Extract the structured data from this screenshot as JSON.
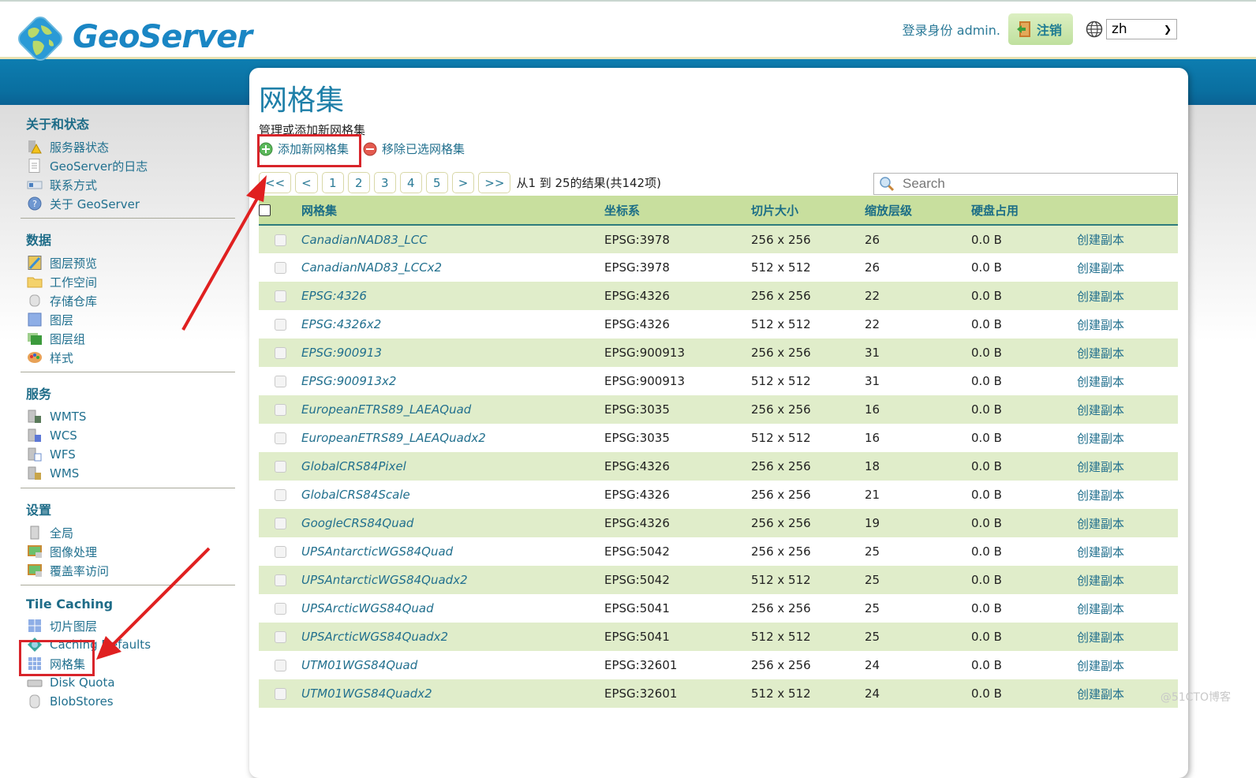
{
  "header": {
    "logo_text": "GeoServer",
    "login_text": "登录身份 admin.",
    "logout_label": "注销",
    "language": "zh"
  },
  "sidebar": {
    "sections": [
      {
        "title": "关于和状态",
        "items": [
          {
            "label": "服务器状态",
            "icon": "server-status-icon"
          },
          {
            "label": "GeoServer的日志",
            "icon": "log-document-icon"
          },
          {
            "label": "联系方式",
            "icon": "contact-card-icon"
          },
          {
            "label": "关于 GeoServer",
            "icon": "about-info-icon"
          }
        ]
      },
      {
        "title": "数据",
        "items": [
          {
            "label": "图层预览",
            "icon": "layer-preview-icon"
          },
          {
            "label": "工作空间",
            "icon": "folder-icon"
          },
          {
            "label": "存储仓库",
            "icon": "database-icon"
          },
          {
            "label": "图层",
            "icon": "layer-icon"
          },
          {
            "label": "图层组",
            "icon": "layer-group-icon"
          },
          {
            "label": "样式",
            "icon": "palette-icon"
          }
        ]
      },
      {
        "title": "服务",
        "items": [
          {
            "label": "WMTS",
            "icon": "wmts-service-icon"
          },
          {
            "label": "WCS",
            "icon": "wcs-service-icon"
          },
          {
            "label": "WFS",
            "icon": "wfs-service-icon"
          },
          {
            "label": "WMS",
            "icon": "wms-service-icon"
          }
        ]
      },
      {
        "title": "设置",
        "items": [
          {
            "label": "全局",
            "icon": "global-server-icon"
          },
          {
            "label": "图像处理",
            "icon": "image-processing-icon"
          },
          {
            "label": "覆盖率访问",
            "icon": "coverage-access-icon"
          }
        ]
      },
      {
        "title": "Tile Caching",
        "items": [
          {
            "label": "切片图层",
            "icon": "tile-layers-icon"
          },
          {
            "label": "Caching Defaults",
            "icon": "caching-defaults-icon"
          },
          {
            "label": "网格集",
            "icon": "gridset-icon"
          },
          {
            "label": "Disk Quota",
            "icon": "disk-quota-icon"
          },
          {
            "label": "BlobStores",
            "icon": "blobstore-icon"
          }
        ]
      }
    ]
  },
  "main": {
    "title": "网格集",
    "description": "管理或添加新网格集",
    "add_label": "添加新网格集",
    "remove_label": "移除已选网格集",
    "pager": {
      "first": "<<",
      "prev": "<",
      "pages": [
        "1",
        "2",
        "3",
        "4",
        "5"
      ],
      "next": ">",
      "last": ">>",
      "info": "从1 到 25的结果(共142项)"
    },
    "search_placeholder": "Search",
    "columns": [
      "网格集",
      "坐标系",
      "切片大小",
      "缩放层级",
      "硬盘占用",
      ""
    ],
    "rows": [
      {
        "name": "CanadianNAD83_LCC",
        "crs": "EPSG:3978",
        "tile_size": "256 x 256",
        "zoom_levels": "26",
        "disk": "0.0 B",
        "action": "创建副本"
      },
      {
        "name": "CanadianNAD83_LCCx2",
        "crs": "EPSG:3978",
        "tile_size": "512 x 512",
        "zoom_levels": "26",
        "disk": "0.0 B",
        "action": "创建副本"
      },
      {
        "name": "EPSG:4326",
        "crs": "EPSG:4326",
        "tile_size": "256 x 256",
        "zoom_levels": "22",
        "disk": "0.0 B",
        "action": "创建副本"
      },
      {
        "name": "EPSG:4326x2",
        "crs": "EPSG:4326",
        "tile_size": "512 x 512",
        "zoom_levels": "22",
        "disk": "0.0 B",
        "action": "创建副本"
      },
      {
        "name": "EPSG:900913",
        "crs": "EPSG:900913",
        "tile_size": "256 x 256",
        "zoom_levels": "31",
        "disk": "0.0 B",
        "action": "创建副本"
      },
      {
        "name": "EPSG:900913x2",
        "crs": "EPSG:900913",
        "tile_size": "512 x 512",
        "zoom_levels": "31",
        "disk": "0.0 B",
        "action": "创建副本"
      },
      {
        "name": "EuropeanETRS89_LAEAQuad",
        "crs": "EPSG:3035",
        "tile_size": "256 x 256",
        "zoom_levels": "16",
        "disk": "0.0 B",
        "action": "创建副本"
      },
      {
        "name": "EuropeanETRS89_LAEAQuadx2",
        "crs": "EPSG:3035",
        "tile_size": "512 x 512",
        "zoom_levels": "16",
        "disk": "0.0 B",
        "action": "创建副本"
      },
      {
        "name": "GlobalCRS84Pixel",
        "crs": "EPSG:4326",
        "tile_size": "256 x 256",
        "zoom_levels": "18",
        "disk": "0.0 B",
        "action": "创建副本"
      },
      {
        "name": "GlobalCRS84Scale",
        "crs": "EPSG:4326",
        "tile_size": "256 x 256",
        "zoom_levels": "21",
        "disk": "0.0 B",
        "action": "创建副本"
      },
      {
        "name": "GoogleCRS84Quad",
        "crs": "EPSG:4326",
        "tile_size": "256 x 256",
        "zoom_levels": "19",
        "disk": "0.0 B",
        "action": "创建副本"
      },
      {
        "name": "UPSAntarcticWGS84Quad",
        "crs": "EPSG:5042",
        "tile_size": "256 x 256",
        "zoom_levels": "25",
        "disk": "0.0 B",
        "action": "创建副本"
      },
      {
        "name": "UPSAntarcticWGS84Quadx2",
        "crs": "EPSG:5042",
        "tile_size": "512 x 512",
        "zoom_levels": "25",
        "disk": "0.0 B",
        "action": "创建副本"
      },
      {
        "name": "UPSArcticWGS84Quad",
        "crs": "EPSG:5041",
        "tile_size": "256 x 256",
        "zoom_levels": "25",
        "disk": "0.0 B",
        "action": "创建副本"
      },
      {
        "name": "UPSArcticWGS84Quadx2",
        "crs": "EPSG:5041",
        "tile_size": "512 x 512",
        "zoom_levels": "25",
        "disk": "0.0 B",
        "action": "创建副本"
      },
      {
        "name": "UTM01WGS84Quad",
        "crs": "EPSG:32601",
        "tile_size": "256 x 256",
        "zoom_levels": "24",
        "disk": "0.0 B",
        "action": "创建副本"
      },
      {
        "name": "UTM01WGS84Quadx2",
        "crs": "EPSG:32601",
        "tile_size": "512 x 512",
        "zoom_levels": "24",
        "disk": "0.0 B",
        "action": "创建副本"
      }
    ]
  },
  "watermark": "@51CTO博客",
  "colors": {
    "brand_blue": "#0a6fa0",
    "header_green": "#c8df9e",
    "row_green": "#e0edca",
    "link": "#22708e",
    "annotation_red": "#d8242a"
  }
}
